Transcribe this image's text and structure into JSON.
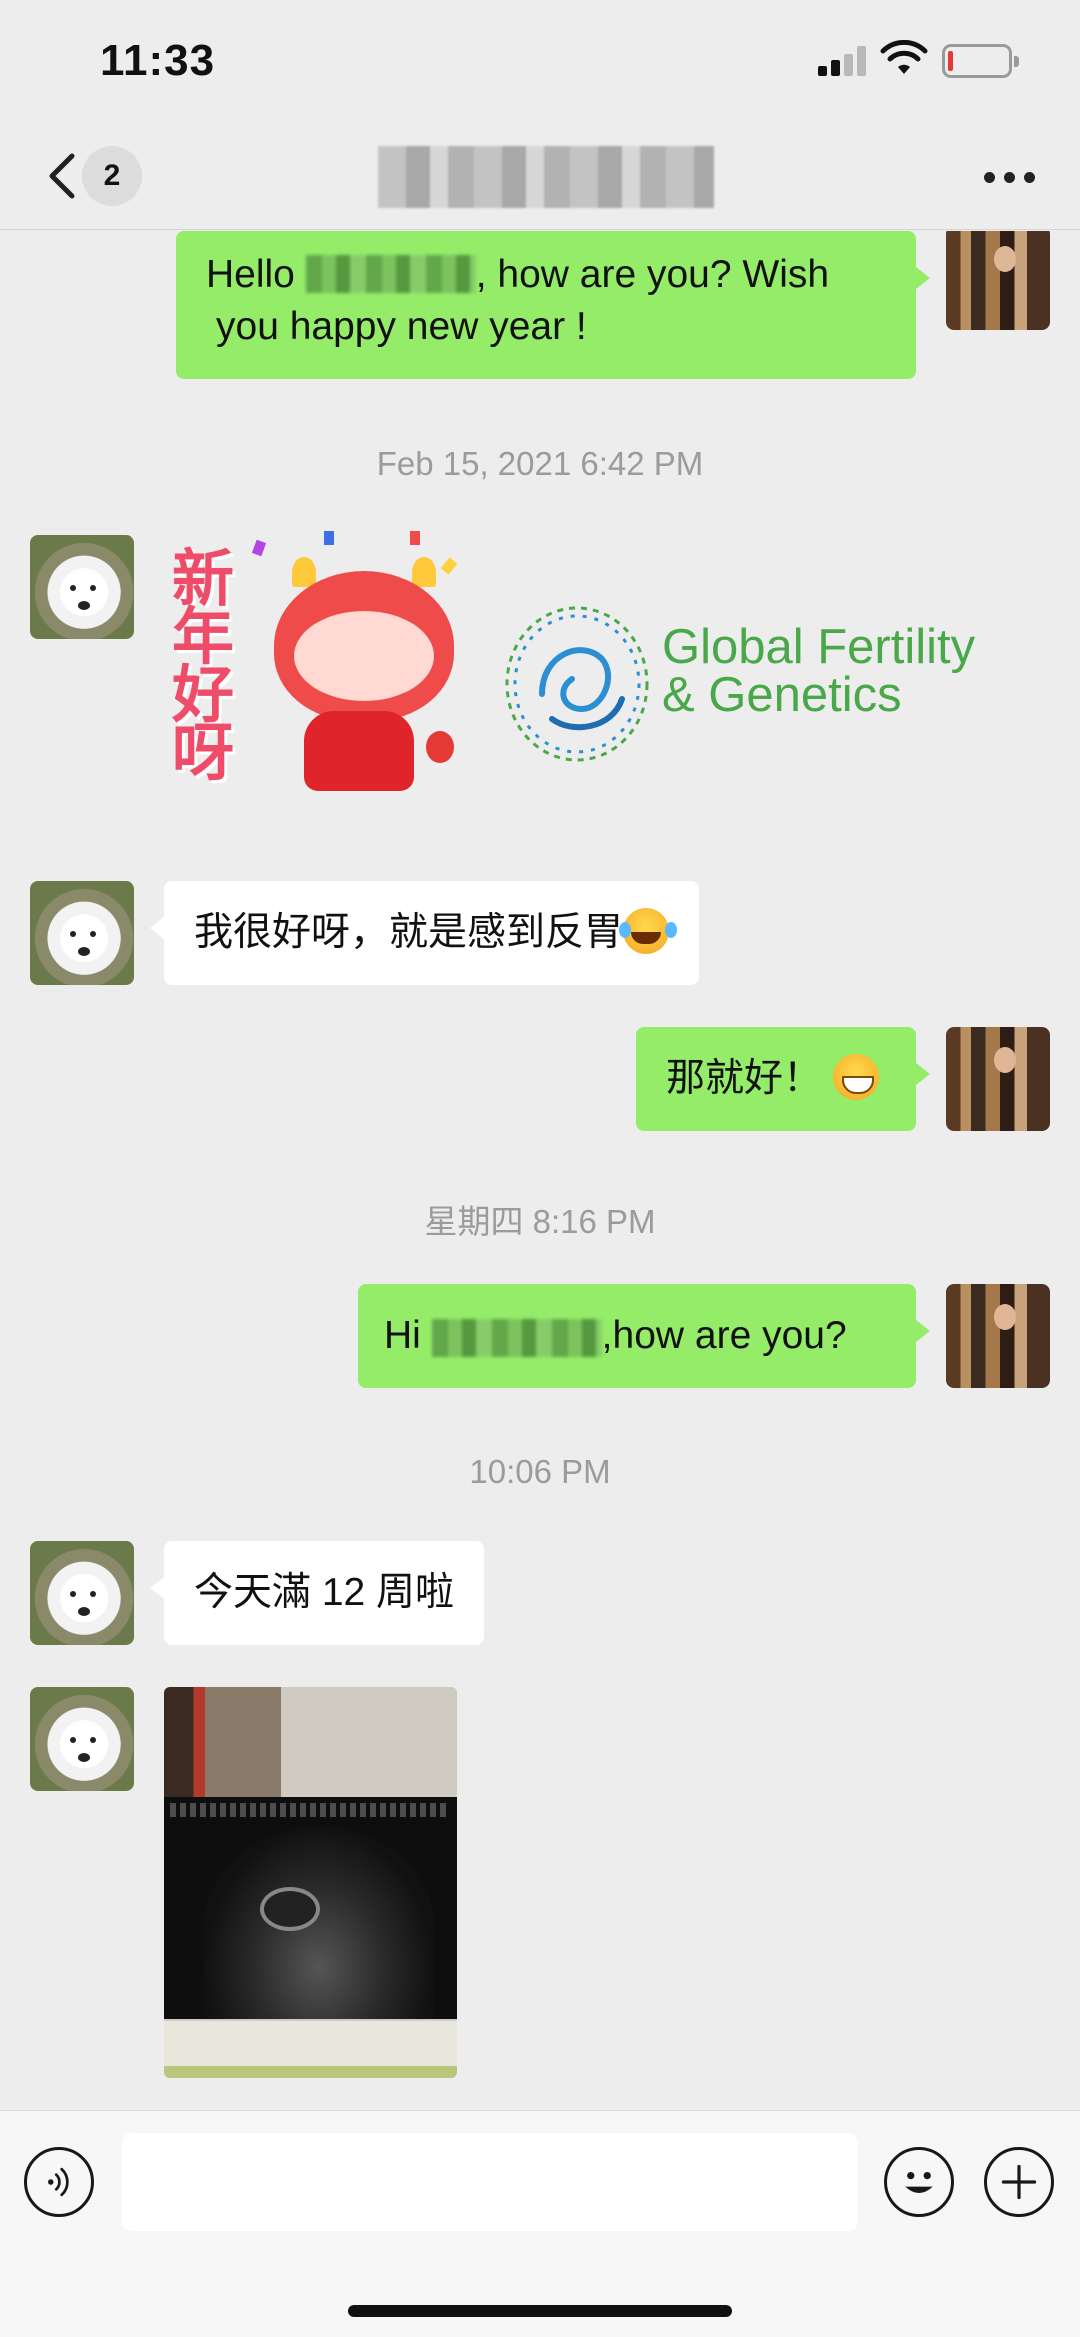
{
  "status_bar": {
    "time": "11:33",
    "icons": [
      "cellular-signal-icon",
      "wifi-icon",
      "battery-low-icon"
    ],
    "battery_color": "#e53935"
  },
  "nav": {
    "unread_count": "2",
    "back_icon": "chevron-left-icon",
    "more_icon": "more-dots-icon"
  },
  "messages": [
    {
      "side": "right",
      "type": "text",
      "parts": [
        "Hello ",
        ", how are you? Wish",
        "you happy new year !"
      ]
    },
    {
      "type": "timestamp",
      "text": "Feb 15, 2021 6:42 PM"
    },
    {
      "side": "left",
      "type": "sticker",
      "sticker_text": "新年好呀",
      "logo_line1": "Global Fertility",
      "logo_line2": "& Genetics"
    },
    {
      "side": "left",
      "type": "text",
      "text": "我很好呀，就是感到反胃",
      "emoji": "tears-of-joy-emoji"
    },
    {
      "side": "right",
      "type": "text",
      "text": "那就好！",
      "emoji": "grinning-sweat-emoji"
    },
    {
      "type": "timestamp",
      "text": "星期四 8:16 PM"
    },
    {
      "side": "right",
      "type": "text",
      "prefix": "Hi ",
      "suffix": ",how are you?"
    },
    {
      "type": "timestamp",
      "text": "10:06 PM"
    },
    {
      "side": "left",
      "type": "text",
      "text": "今天滿 12 周啦"
    },
    {
      "side": "left",
      "type": "image",
      "image_kind": "ultrasound-photo"
    }
  ],
  "colors": {
    "background": "#ededed",
    "sent_bubble": "#95ec69",
    "received_bubble": "#ffffff",
    "timestamp": "#9b9b9b",
    "logo_green": "#4aa84a",
    "logo_blue": "#2b8fd1"
  },
  "input_bar": {
    "voice_icon": "voice-icon",
    "emoji_icon": "smiley-icon",
    "plus_icon": "plus-icon"
  }
}
